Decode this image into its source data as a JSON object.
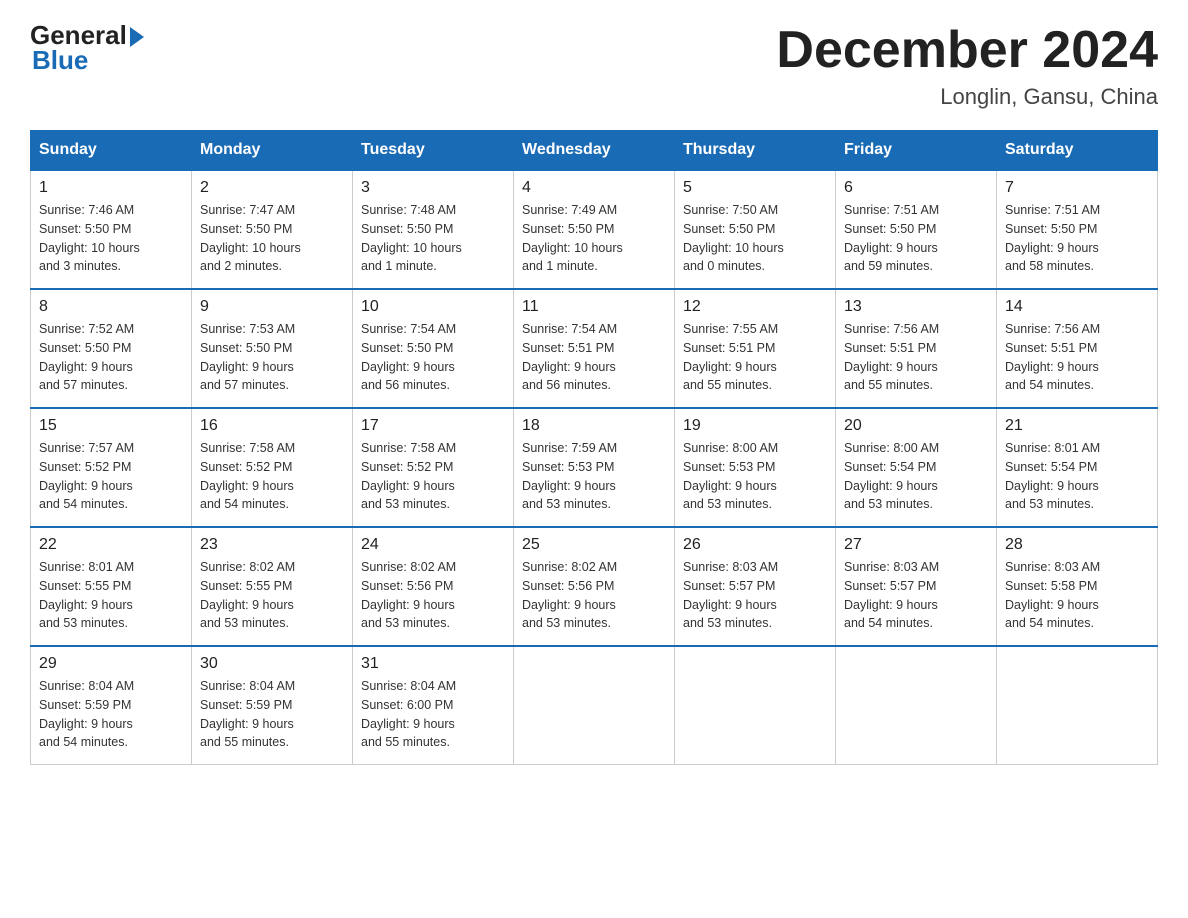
{
  "header": {
    "logo_general": "General",
    "logo_blue": "Blue",
    "month_title": "December 2024",
    "location": "Longlin, Gansu, China"
  },
  "days_of_week": [
    "Sunday",
    "Monday",
    "Tuesday",
    "Wednesday",
    "Thursday",
    "Friday",
    "Saturday"
  ],
  "weeks": [
    [
      {
        "day": "1",
        "info": "Sunrise: 7:46 AM\nSunset: 5:50 PM\nDaylight: 10 hours\nand 3 minutes."
      },
      {
        "day": "2",
        "info": "Sunrise: 7:47 AM\nSunset: 5:50 PM\nDaylight: 10 hours\nand 2 minutes."
      },
      {
        "day": "3",
        "info": "Sunrise: 7:48 AM\nSunset: 5:50 PM\nDaylight: 10 hours\nand 1 minute."
      },
      {
        "day": "4",
        "info": "Sunrise: 7:49 AM\nSunset: 5:50 PM\nDaylight: 10 hours\nand 1 minute."
      },
      {
        "day": "5",
        "info": "Sunrise: 7:50 AM\nSunset: 5:50 PM\nDaylight: 10 hours\nand 0 minutes."
      },
      {
        "day": "6",
        "info": "Sunrise: 7:51 AM\nSunset: 5:50 PM\nDaylight: 9 hours\nand 59 minutes."
      },
      {
        "day": "7",
        "info": "Sunrise: 7:51 AM\nSunset: 5:50 PM\nDaylight: 9 hours\nand 58 minutes."
      }
    ],
    [
      {
        "day": "8",
        "info": "Sunrise: 7:52 AM\nSunset: 5:50 PM\nDaylight: 9 hours\nand 57 minutes."
      },
      {
        "day": "9",
        "info": "Sunrise: 7:53 AM\nSunset: 5:50 PM\nDaylight: 9 hours\nand 57 minutes."
      },
      {
        "day": "10",
        "info": "Sunrise: 7:54 AM\nSunset: 5:50 PM\nDaylight: 9 hours\nand 56 minutes."
      },
      {
        "day": "11",
        "info": "Sunrise: 7:54 AM\nSunset: 5:51 PM\nDaylight: 9 hours\nand 56 minutes."
      },
      {
        "day": "12",
        "info": "Sunrise: 7:55 AM\nSunset: 5:51 PM\nDaylight: 9 hours\nand 55 minutes."
      },
      {
        "day": "13",
        "info": "Sunrise: 7:56 AM\nSunset: 5:51 PM\nDaylight: 9 hours\nand 55 minutes."
      },
      {
        "day": "14",
        "info": "Sunrise: 7:56 AM\nSunset: 5:51 PM\nDaylight: 9 hours\nand 54 minutes."
      }
    ],
    [
      {
        "day": "15",
        "info": "Sunrise: 7:57 AM\nSunset: 5:52 PM\nDaylight: 9 hours\nand 54 minutes."
      },
      {
        "day": "16",
        "info": "Sunrise: 7:58 AM\nSunset: 5:52 PM\nDaylight: 9 hours\nand 54 minutes."
      },
      {
        "day": "17",
        "info": "Sunrise: 7:58 AM\nSunset: 5:52 PM\nDaylight: 9 hours\nand 53 minutes."
      },
      {
        "day": "18",
        "info": "Sunrise: 7:59 AM\nSunset: 5:53 PM\nDaylight: 9 hours\nand 53 minutes."
      },
      {
        "day": "19",
        "info": "Sunrise: 8:00 AM\nSunset: 5:53 PM\nDaylight: 9 hours\nand 53 minutes."
      },
      {
        "day": "20",
        "info": "Sunrise: 8:00 AM\nSunset: 5:54 PM\nDaylight: 9 hours\nand 53 minutes."
      },
      {
        "day": "21",
        "info": "Sunrise: 8:01 AM\nSunset: 5:54 PM\nDaylight: 9 hours\nand 53 minutes."
      }
    ],
    [
      {
        "day": "22",
        "info": "Sunrise: 8:01 AM\nSunset: 5:55 PM\nDaylight: 9 hours\nand 53 minutes."
      },
      {
        "day": "23",
        "info": "Sunrise: 8:02 AM\nSunset: 5:55 PM\nDaylight: 9 hours\nand 53 minutes."
      },
      {
        "day": "24",
        "info": "Sunrise: 8:02 AM\nSunset: 5:56 PM\nDaylight: 9 hours\nand 53 minutes."
      },
      {
        "day": "25",
        "info": "Sunrise: 8:02 AM\nSunset: 5:56 PM\nDaylight: 9 hours\nand 53 minutes."
      },
      {
        "day": "26",
        "info": "Sunrise: 8:03 AM\nSunset: 5:57 PM\nDaylight: 9 hours\nand 53 minutes."
      },
      {
        "day": "27",
        "info": "Sunrise: 8:03 AM\nSunset: 5:57 PM\nDaylight: 9 hours\nand 54 minutes."
      },
      {
        "day": "28",
        "info": "Sunrise: 8:03 AM\nSunset: 5:58 PM\nDaylight: 9 hours\nand 54 minutes."
      }
    ],
    [
      {
        "day": "29",
        "info": "Sunrise: 8:04 AM\nSunset: 5:59 PM\nDaylight: 9 hours\nand 54 minutes."
      },
      {
        "day": "30",
        "info": "Sunrise: 8:04 AM\nSunset: 5:59 PM\nDaylight: 9 hours\nand 55 minutes."
      },
      {
        "day": "31",
        "info": "Sunrise: 8:04 AM\nSunset: 6:00 PM\nDaylight: 9 hours\nand 55 minutes."
      },
      null,
      null,
      null,
      null
    ]
  ]
}
